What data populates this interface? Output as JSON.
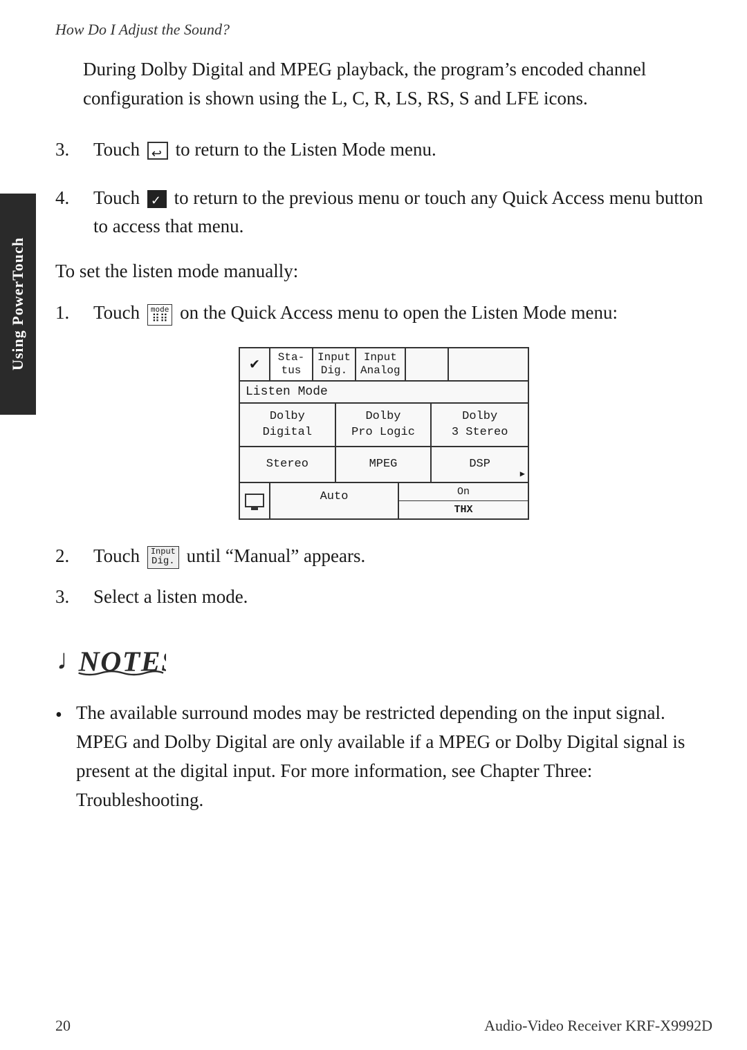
{
  "breadcrumb": "How Do I Adjust the Sound?",
  "sidebar": {
    "label": "Using PowerTouch"
  },
  "intro": {
    "text": "During Dolby Digital and MPEG playback, the program’s encoded channel configuration is shown using the L, C, R, LS, RS, S and LFE icons."
  },
  "steps_before": [
    {
      "num": "3.",
      "text": " to return to the Listen Mode menu."
    },
    {
      "num": "4.",
      "text": " to return to the previous menu or touch any Quick Access menu button to access that menu."
    }
  ],
  "section_heading": "To set the listen mode manually:",
  "steps_manual": [
    {
      "num": "1.",
      "text": " on the Quick Access menu to open the Listen Mode menu:"
    }
  ],
  "menu": {
    "check": "✔",
    "tabs": [
      {
        "label": "Sta-\ntus",
        "selected": true
      },
      {
        "label": "Input\nDig.",
        "selected": false
      },
      {
        "label": "Input\nAnalog",
        "selected": false
      },
      {
        "label": "",
        "selected": false
      },
      {
        "label": "",
        "selected": false
      }
    ],
    "section_label": "Listen Mode",
    "cells": [
      {
        "text": "Dolby\nDigital"
      },
      {
        "text": "Dolby\nPro Logic"
      },
      {
        "text": "Dolby\n3 Stereo"
      },
      {
        "text": "Stereo"
      },
      {
        "text": "MPEG"
      },
      {
        "text": "DSP"
      },
      {
        "text": ""
      },
      {
        "text": "Auto"
      },
      {
        "text": "On\nTHX"
      }
    ]
  },
  "step2": {
    "num": "2.",
    "text": "Touch",
    "icon_label": "Input\nDig.",
    "suffix": "until “Manual” appears."
  },
  "step3": {
    "num": "3.",
    "text": "Select a listen mode."
  },
  "notes": {
    "bullet1": "The available surround modes may be restricted depending on the input signal. MPEG and Dolby Digital are only available if a MPEG or Dolby Digital signal is present at the digital input. For more information, see Chapter Three: Troubleshooting."
  },
  "footer": {
    "page_num": "20",
    "product": "Audio-Video Receiver KRF-X9992D"
  }
}
